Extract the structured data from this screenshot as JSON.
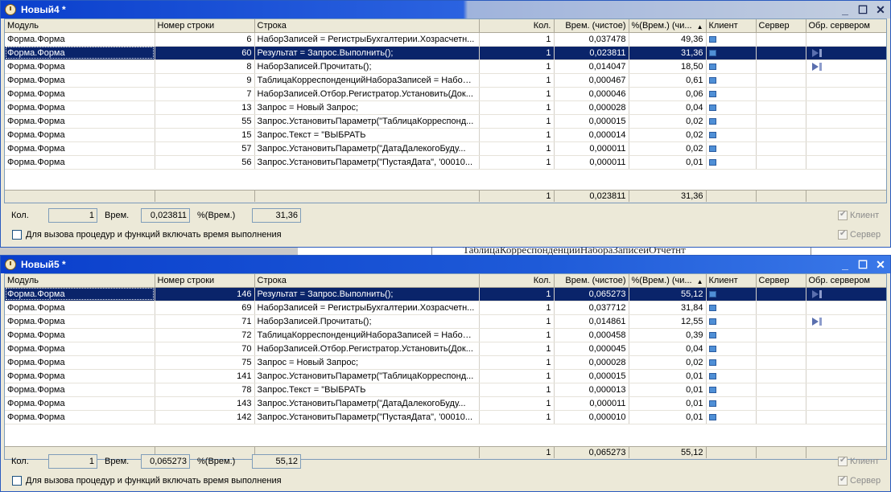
{
  "window1": {
    "title": "Новый4 *",
    "columns": [
      "Модуль",
      "Номер строки",
      "Строка",
      "Кол.",
      "Врем. (чистое)",
      "%(Врем.) (чи...",
      "Клиент",
      "Сервер",
      "Обр. сервером"
    ],
    "sort_marker": "▲",
    "rows": [
      {
        "module": "Форма.Форма",
        "line": "6",
        "code": "НаборЗаписей = РегистрыБухгалтерии.Хозрасчетн...",
        "count": "1",
        "time": "0,037478",
        "pct": "49,36",
        "server_call": false
      },
      {
        "module": "Форма.Форма",
        "line": "60",
        "code": "Результат = Запрос.Выполнить();",
        "count": "1",
        "time": "0,023811",
        "pct": "31,36",
        "server_call": true
      },
      {
        "module": "Форма.Форма",
        "line": "8",
        "code": "НаборЗаписей.Прочитать();",
        "count": "1",
        "time": "0,014047",
        "pct": "18,50",
        "server_call": true
      },
      {
        "module": "Форма.Форма",
        "line": "9",
        "code": "ТаблицаКорреспонденцийНабораЗаписей = НаборЗ...",
        "count": "1",
        "time": "0,000467",
        "pct": "0,61",
        "server_call": false
      },
      {
        "module": "Форма.Форма",
        "line": "7",
        "code": "НаборЗаписей.Отбор.Регистратор.Установить(Док...",
        "count": "1",
        "time": "0,000046",
        "pct": "0,06",
        "server_call": false
      },
      {
        "module": "Форма.Форма",
        "line": "13",
        "code": "Запрос = Новый Запрос;",
        "count": "1",
        "time": "0,000028",
        "pct": "0,04",
        "server_call": false
      },
      {
        "module": "Форма.Форма",
        "line": "55",
        "code": "Запрос.УстановитьПараметр(\"ТаблицаКорреспонд...",
        "count": "1",
        "time": "0,000015",
        "pct": "0,02",
        "server_call": false
      },
      {
        "module": "Форма.Форма",
        "line": "15",
        "code": "Запрос.Текст = \"ВЫБРАТЬ",
        "count": "1",
        "time": "0,000014",
        "pct": "0,02",
        "server_call": false
      },
      {
        "module": "Форма.Форма",
        "line": "57",
        "code": "Запрос.УстановитьПараметр(\"ДатаДалекогоБуду...",
        "count": "1",
        "time": "0,000011",
        "pct": "0,02",
        "server_call": false
      },
      {
        "module": "Форма.Форма",
        "line": "56",
        "code": "Запрос.УстановитьПараметр(\"ПустаяДата\", '00010...",
        "count": "1",
        "time": "0,000011",
        "pct": "0,01",
        "server_call": false
      }
    ],
    "selected_row": 1,
    "totals": {
      "count": "1",
      "time": "0,023811",
      "pct": "31,36"
    },
    "footer": {
      "count_label": "Кол.",
      "count_value": "1",
      "time_label": "Врем.",
      "time_value": "0,023811",
      "pct_label": "%(Врем.)",
      "pct_value": "31,36",
      "include_label": "Для вызова процедур и функций включать время выполнения",
      "client_label": "Клиент",
      "server_label": "Сервер"
    }
  },
  "background_text": "ТаблицаКорреспонденцийНабораЗаписейОтчетнт",
  "window2": {
    "title": "Новый5 *",
    "columns": [
      "Модуль",
      "Номер строки",
      "Строка",
      "Кол.",
      "Врем. (чистое)",
      "%(Врем.) (чи...",
      "Клиент",
      "Сервер",
      "Обр. сервером"
    ],
    "sort_marker": "▲",
    "rows": [
      {
        "module": "Форма.Форма",
        "line": "146",
        "code": "Результат = Запрос.Выполнить();",
        "count": "1",
        "time": "0,065273",
        "pct": "55,12",
        "server_call": true
      },
      {
        "module": "Форма.Форма",
        "line": "69",
        "code": "НаборЗаписей = РегистрыБухгалтерии.Хозрасчетн...",
        "count": "1",
        "time": "0,037712",
        "pct": "31,84",
        "server_call": false
      },
      {
        "module": "Форма.Форма",
        "line": "71",
        "code": "НаборЗаписей.Прочитать();",
        "count": "1",
        "time": "0,014861",
        "pct": "12,55",
        "server_call": true
      },
      {
        "module": "Форма.Форма",
        "line": "72",
        "code": "ТаблицаКорреспонденцийНабораЗаписей = НаборЗ...",
        "count": "1",
        "time": "0,000458",
        "pct": "0,39",
        "server_call": false
      },
      {
        "module": "Форма.Форма",
        "line": "70",
        "code": "НаборЗаписей.Отбор.Регистратор.Установить(Док...",
        "count": "1",
        "time": "0,000045",
        "pct": "0,04",
        "server_call": false
      },
      {
        "module": "Форма.Форма",
        "line": "75",
        "code": "Запрос = Новый Запрос;",
        "count": "1",
        "time": "0,000028",
        "pct": "0,02",
        "server_call": false
      },
      {
        "module": "Форма.Форма",
        "line": "141",
        "code": "Запрос.УстановитьПараметр(\"ТаблицаКорреспонд...",
        "count": "1",
        "time": "0,000015",
        "pct": "0,01",
        "server_call": false
      },
      {
        "module": "Форма.Форма",
        "line": "78",
        "code": "Запрос.Текст = \"ВЫБРАТЬ",
        "count": "1",
        "time": "0,000013",
        "pct": "0,01",
        "server_call": false
      },
      {
        "module": "Форма.Форма",
        "line": "143",
        "code": "Запрос.УстановитьПараметр(\"ДатаДалекогоБуду...",
        "count": "1",
        "time": "0,000011",
        "pct": "0,01",
        "server_call": false
      },
      {
        "module": "Форма.Форма",
        "line": "142",
        "code": "Запрос.УстановитьПараметр(\"ПустаяДата\", '00010...",
        "count": "1",
        "time": "0,000010",
        "pct": "0,01",
        "server_call": false
      }
    ],
    "selected_row": 0,
    "totals": {
      "count": "1",
      "time": "0,065273",
      "pct": "55,12"
    },
    "footer": {
      "count_label": "Кол.",
      "count_value": "1",
      "time_label": "Врем.",
      "time_value": "0,065273",
      "pct_label": "%(Врем.)",
      "pct_value": "55,12",
      "include_label": "Для вызова процедур и функций включать время выполнения",
      "client_label": "Клиент",
      "server_label": "Сервер"
    }
  },
  "icons": {
    "window": "clock-icon",
    "client": "monitor-icon",
    "server_call": "server-arrow-icon"
  },
  "colors": {
    "selection": "#0a246a",
    "title_active": "#0a3fcc",
    "panel": "#ece9d8"
  }
}
